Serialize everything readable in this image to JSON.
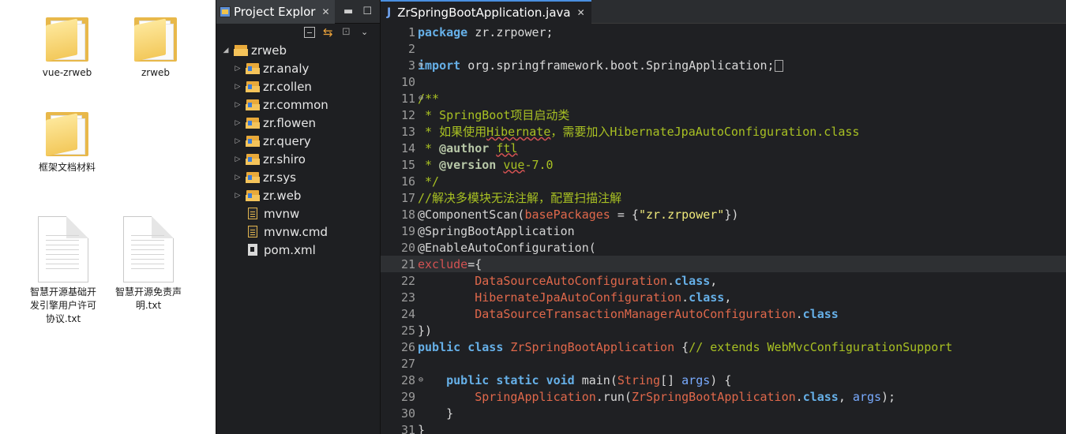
{
  "desktop": {
    "items": [
      {
        "label": "vue-zrweb"
      },
      {
        "label": "zrweb"
      },
      {
        "label": "框架文档材料"
      },
      {
        "label_lines": [
          "智慧开源基础开",
          "发引擎用户许可",
          "协议.txt"
        ]
      },
      {
        "label_lines": [
          "智慧开源免责声",
          "明.txt"
        ]
      }
    ]
  },
  "explorer": {
    "tab_title": "Project Explor",
    "tree": [
      {
        "label": "zrweb",
        "type": "project",
        "expanded": true
      },
      {
        "label": "zr.analy",
        "type": "package"
      },
      {
        "label": "zr.collen",
        "type": "package"
      },
      {
        "label": "zr.common",
        "type": "package"
      },
      {
        "label": "zr.flowen",
        "type": "package"
      },
      {
        "label": "zr.query",
        "type": "package"
      },
      {
        "label": "zr.shiro",
        "type": "package"
      },
      {
        "label": "zr.sys",
        "type": "package"
      },
      {
        "label": "zr.web",
        "type": "package"
      },
      {
        "label": "mvnw",
        "type": "file"
      },
      {
        "label": "mvnw.cmd",
        "type": "file"
      },
      {
        "label": "pom.xml",
        "type": "xml"
      }
    ]
  },
  "editor": {
    "tab_title": "ZrSpringBootApplication.java",
    "line_numbers": [
      "1",
      "2",
      "3",
      "10",
      "11",
      "12",
      "13",
      "14",
      "15",
      "16",
      "17",
      "18",
      "19",
      "20",
      "21",
      "22",
      "23",
      "24",
      "25",
      "26",
      "27",
      "28",
      "29",
      "30",
      "31"
    ],
    "code": {
      "l1_kw": "package",
      "l1_rest": " zr.zrpower;",
      "l3_kw": "import",
      "l3_rest": " org.springframework.boot.SpringApplication;",
      "l11": "/**",
      "l12": " * SpringBoot项目启动类",
      "l13a": " * 如果使用",
      "l13b": "Hibernate",
      "l13c": "，需要加入HibernateJpaAutoConfiguration.class",
      "l14a": " * ",
      "l14tag": "@author",
      "l14b": " ",
      "l14c": "ftl",
      "l15a": " * ",
      "l15tag": "@version",
      "l15b": " ",
      "l15c": "vue",
      "l15d": "-7.0",
      "l16": " */",
      "l17": "//解决多模块无法注解，配置扫描注解",
      "l18a": "@ComponentScan(",
      "l18b": "basePackages",
      "l18c": " = {",
      "l18d": "\"zr.zrpower\"",
      "l18e": "})",
      "l19": "@SpringBootApplication",
      "l20": "@EnableAutoConfiguration(",
      "l21a": "exclude",
      "l21b": "={",
      "l22a": "        DataSourceAutoConfiguration",
      "l22b": ".",
      "l22c": "class",
      "l22d": ",",
      "l23a": "        HibernateJpaAutoConfiguration",
      "l23b": ".",
      "l23c": "class",
      "l23d": ",",
      "l24a": "        DataSourceTransactionManagerAutoConfiguration",
      "l24b": ".",
      "l24c": "class",
      "l25": "})",
      "l26a": "public",
      "l26b": " ",
      "l26c": "class",
      "l26d": " ",
      "l26e": "ZrSpringBootApplication",
      "l26f": " {",
      "l26g": "// extends WebMvcConfigurationSupport",
      "l28a": "    ",
      "l28b": "public",
      "l28c": " ",
      "l28d": "static",
      "l28e": " ",
      "l28f": "void",
      "l28g": " main(",
      "l28h": "String",
      "l28i": "[] ",
      "l28j": "args",
      "l28k": ") {",
      "l29a": "        SpringApplication",
      "l29b": ".run(",
      "l29c": "ZrSpringBootApplication",
      "l29d": ".",
      "l29e": "class",
      "l29f": ", ",
      "l29g": "args",
      "l29h": ");",
      "l30": "    }",
      "l31": "}"
    }
  }
}
